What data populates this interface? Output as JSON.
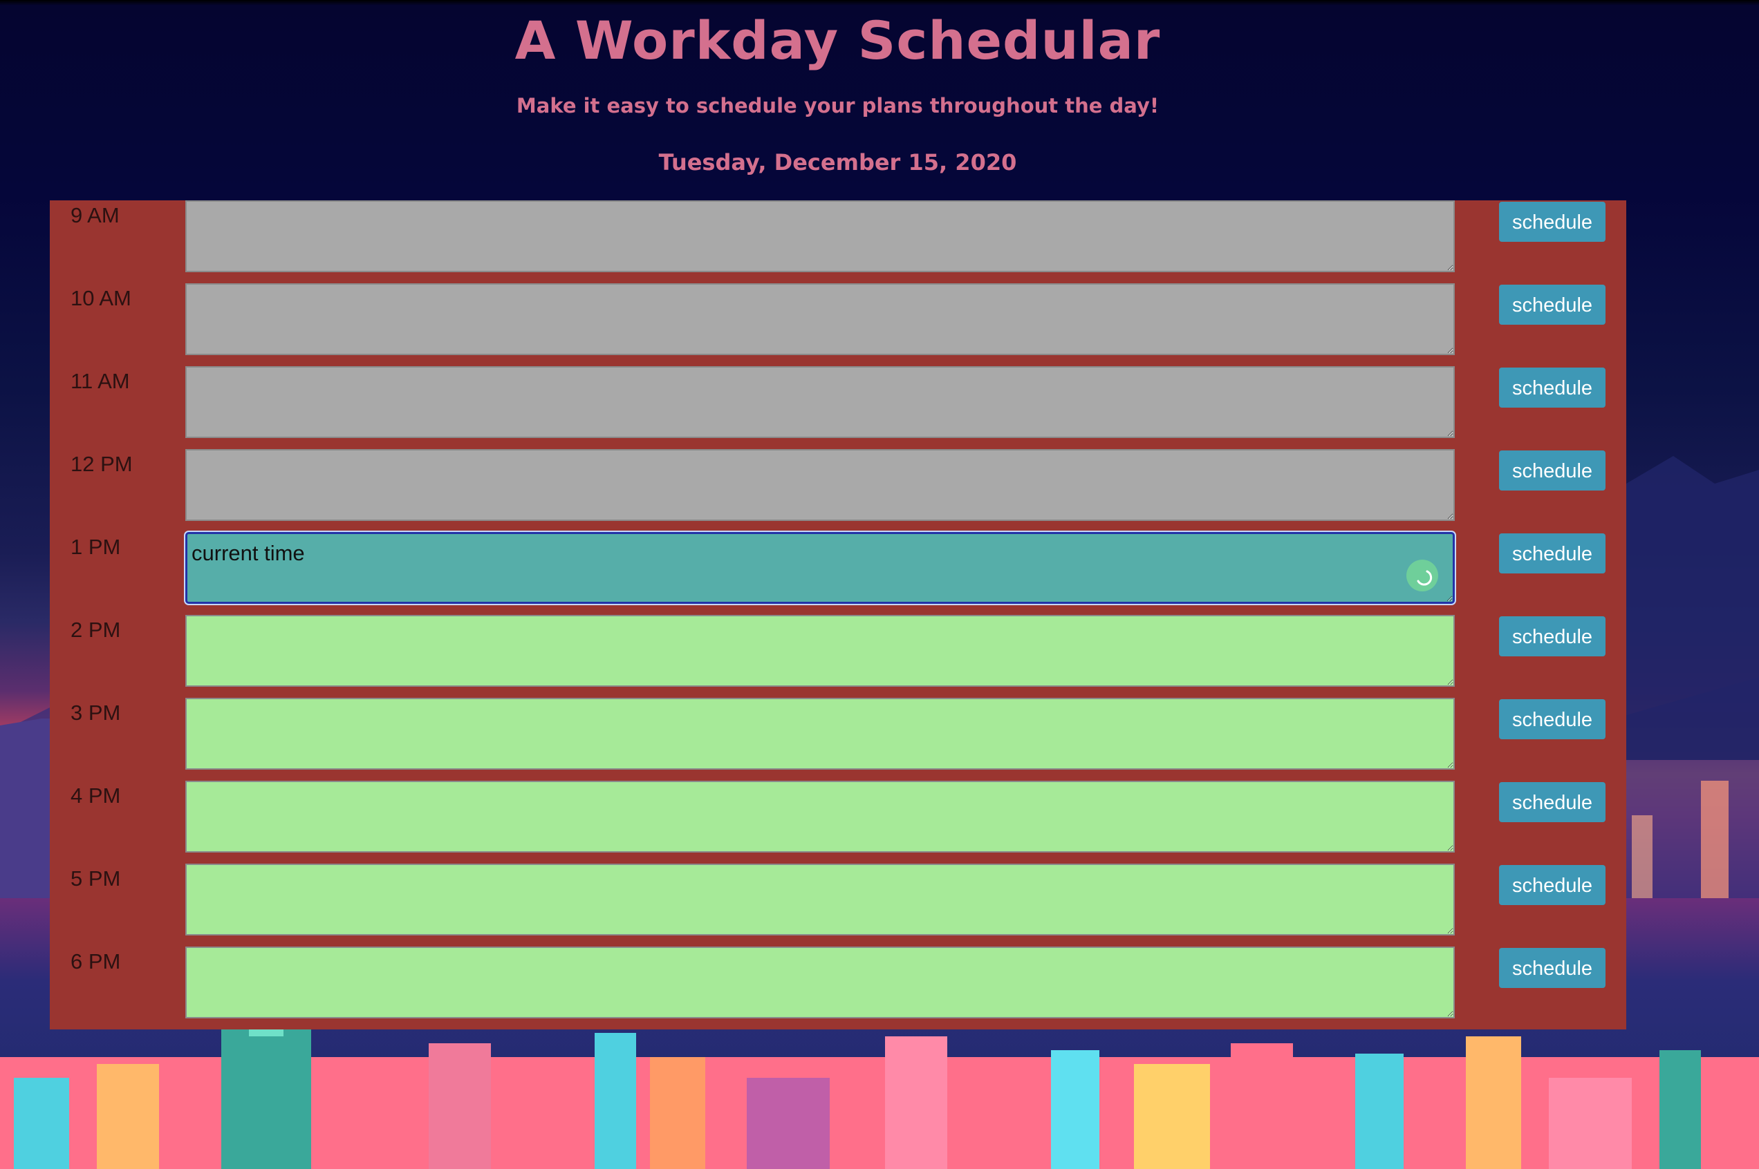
{
  "header": {
    "title": "A Workday Schedular",
    "subtitle": "Make it easy to schedule your plans throughout the day!",
    "date": "Tuesday, December 15, 2020"
  },
  "rows": [
    {
      "hour": "9 AM",
      "text": "",
      "state": "past",
      "button": "schedule"
    },
    {
      "hour": "10 AM",
      "text": "",
      "state": "past",
      "button": "schedule"
    },
    {
      "hour": "11 AM",
      "text": "",
      "state": "past",
      "button": "schedule"
    },
    {
      "hour": "12 PM",
      "text": "",
      "state": "past",
      "button": "schedule"
    },
    {
      "hour": "1 PM",
      "text": "current time",
      "state": "present",
      "button": "schedule"
    },
    {
      "hour": "2 PM",
      "text": "",
      "state": "future",
      "button": "schedule"
    },
    {
      "hour": "3 PM",
      "text": "",
      "state": "future",
      "button": "schedule"
    },
    {
      "hour": "4 PM",
      "text": "",
      "state": "future",
      "button": "schedule"
    },
    {
      "hour": "5 PM",
      "text": "",
      "state": "future",
      "button": "schedule"
    },
    {
      "hour": "6 PM",
      "text": "",
      "state": "future",
      "button": "schedule"
    }
  ],
  "colors": {
    "title": "#d4708e",
    "planner_bg": "#9a3530",
    "past": "#a9a9a9",
    "present": "#56aea9",
    "future": "#a6ea98",
    "button": "#3e98b6"
  }
}
